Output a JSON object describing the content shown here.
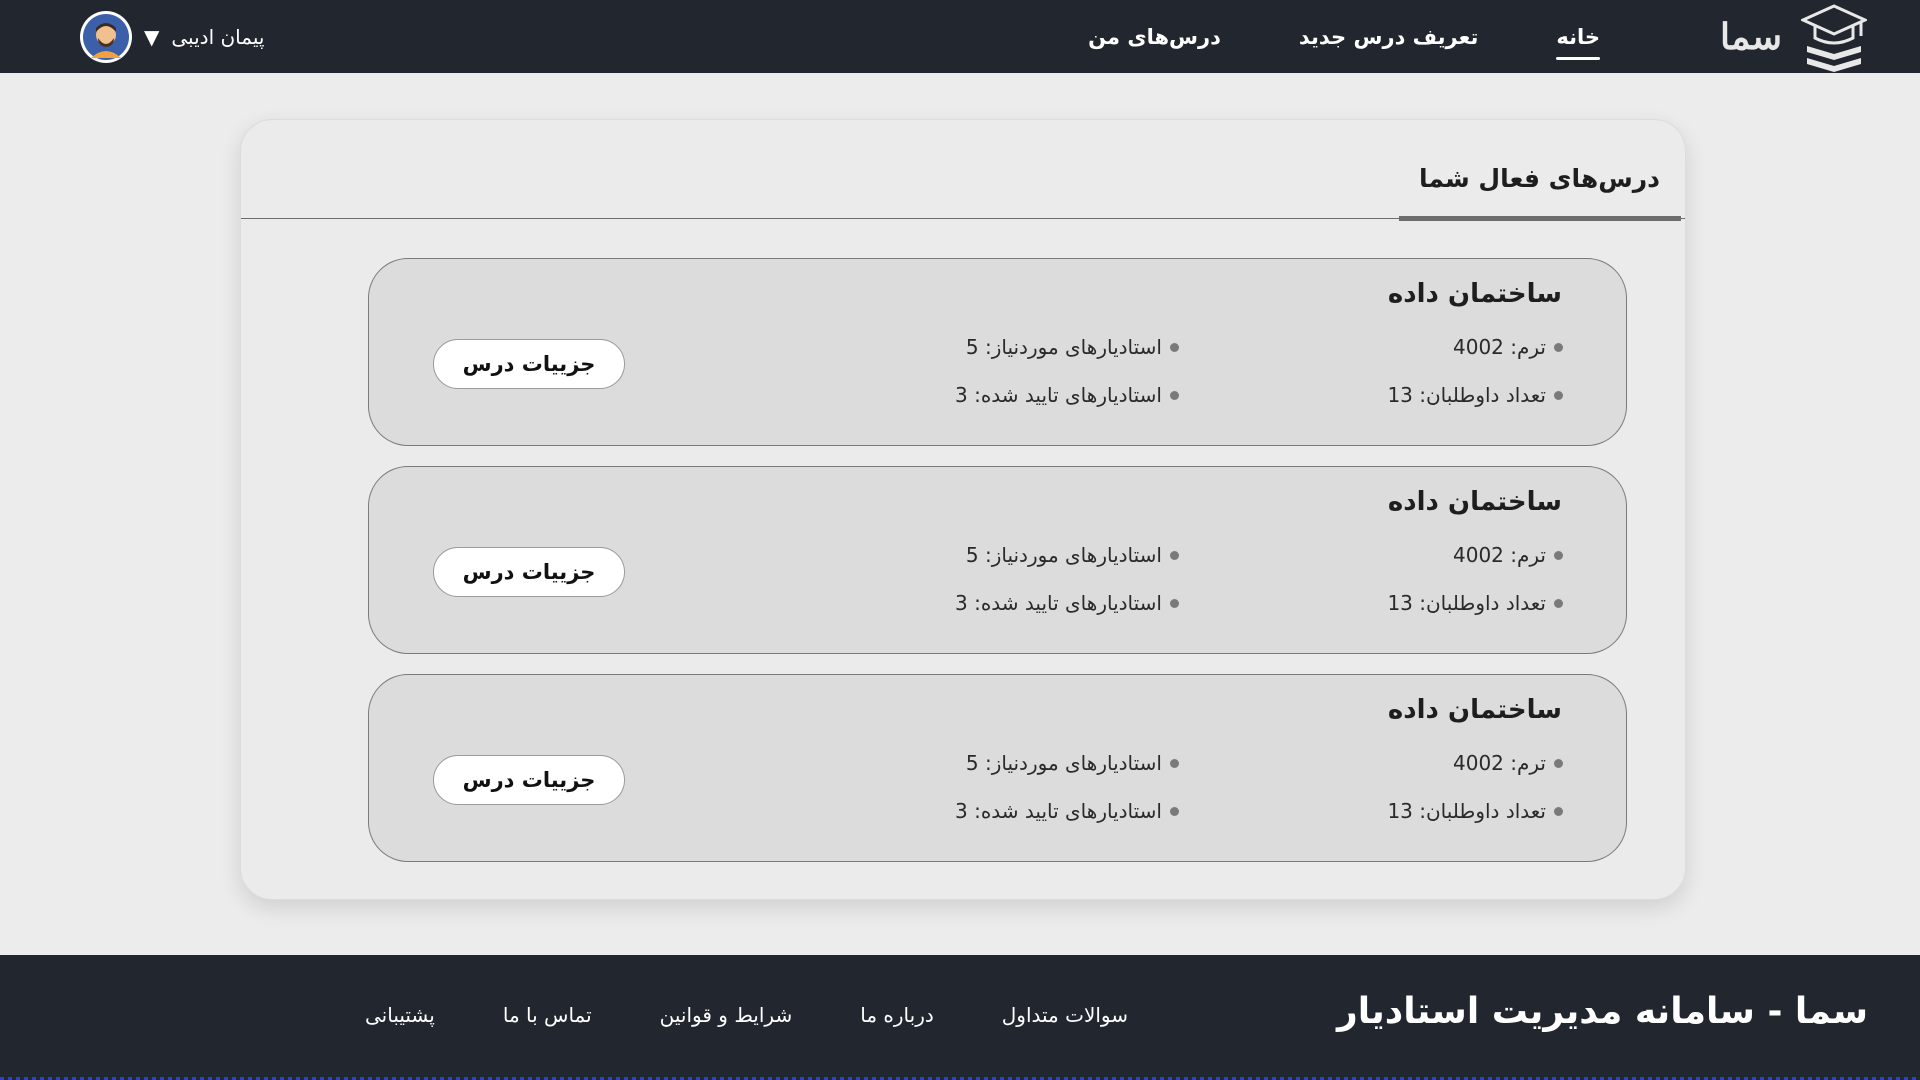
{
  "header": {
    "brand_name": "سما",
    "logo_icon": "graduation-cap-books-icon",
    "nav": [
      {
        "label": "خانه",
        "active": true
      },
      {
        "label": "تعریف درس جدید",
        "active": false
      },
      {
        "label": "درس‌های من",
        "active": false
      }
    ],
    "user": {
      "name": "پیمان ادیبی",
      "caret": "▼",
      "avatar_icon": "user-avatar-icon"
    }
  },
  "panel": {
    "title": "درس‌های فعال شما",
    "courses": [
      {
        "title": "ساختمان داده",
        "term": "ترم: 4002",
        "volunteers": "تعداد داوطلبان: 13",
        "required_tas": "استادیارهای موردنیاز: 5",
        "approved_tas": "استادیارهای تایید شده: 3",
        "button": "جزییات درس"
      },
      {
        "title": "ساختمان داده",
        "term": "ترم: 4002",
        "volunteers": "تعداد داوطلبان: 13",
        "required_tas": "استادیارهای موردنیاز: 5",
        "approved_tas": "استادیارهای تایید شده: 3",
        "button": "جزییات درس"
      },
      {
        "title": "ساختمان داده",
        "term": "ترم: 4002",
        "volunteers": "تعداد داوطلبان: 13",
        "required_tas": "استادیارهای موردنیاز: 5",
        "approved_tas": "استادیارهای تایید شده: 3",
        "button": "جزییات درس"
      }
    ]
  },
  "footer": {
    "title": "سما - سامانه مدیریت استادیار",
    "links": [
      "سوالات متداول",
      "درباره ما",
      "شرایط و قوانین",
      "تماس با ما",
      "پشتیبانی"
    ]
  },
  "colors": {
    "header_bg": "#22262f",
    "page_bg": "#ececec",
    "card_bg": "#dcdcdc",
    "button_bg": "#ffffff"
  }
}
